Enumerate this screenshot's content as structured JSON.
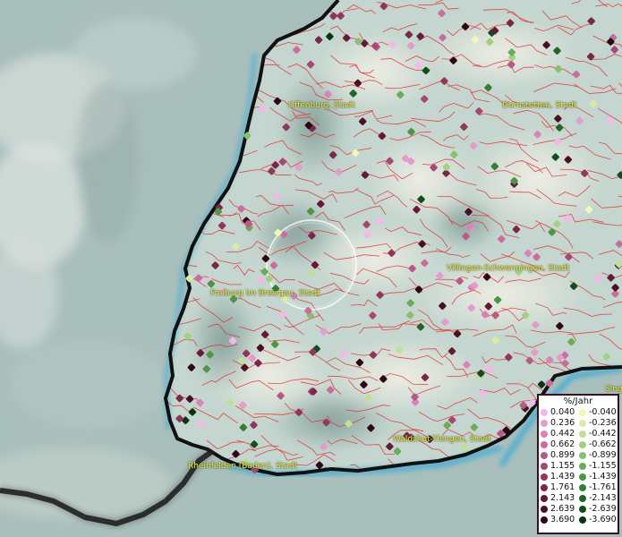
{
  "map": {
    "place_labels": [
      {
        "id": "offenburg",
        "text": "Offenburg, Stadt"
      },
      {
        "id": "dornstetten",
        "text": "Dornstetten, Stadt"
      },
      {
        "id": "villingen",
        "text": "Villingen-Schwenningen, Stadt"
      },
      {
        "id": "freiburg",
        "text": "Freiburg im Breisgau, Stadt"
      },
      {
        "id": "waldshut",
        "text": "Waldshut-Tiengen, Stadt"
      },
      {
        "id": "rheinfelden",
        "text": "Rheinfelden (Baden), Stadt"
      },
      {
        "id": "singen",
        "text": "Sing"
      }
    ],
    "colors": {
      "land": "#c9d8d0",
      "water": "#8fb0b0",
      "boundary": "#e03030",
      "border_outline": "#111111",
      "lake_shore": "#35a8d8",
      "label": "#e8f04a"
    }
  },
  "legend": {
    "title": "%/Jahr",
    "positive": [
      {
        "value": "0.040",
        "color": "#f4b8e8"
      },
      {
        "value": "0.236",
        "color": "#e49ccc"
      },
      {
        "value": "0.442",
        "color": "#d884b8"
      },
      {
        "value": "0.662",
        "color": "#c86e9e"
      },
      {
        "value": "0.899",
        "color": "#b85a88"
      },
      {
        "value": "1.155",
        "color": "#a54872"
      },
      {
        "value": "1.439",
        "color": "#90385c"
      },
      {
        "value": "1.761",
        "color": "#7a2848"
      },
      {
        "value": "2.143",
        "color": "#641a36"
      },
      {
        "value": "2.639",
        "color": "#4a0f24"
      },
      {
        "value": "3.690",
        "color": "#2e0614"
      }
    ],
    "negative": [
      {
        "value": "-0.040",
        "color": "#f0f8b8"
      },
      {
        "value": "-0.236",
        "color": "#d8eca8"
      },
      {
        "value": "-0.442",
        "color": "#c0e098"
      },
      {
        "value": "-0.662",
        "color": "#a4d084"
      },
      {
        "value": "-0.899",
        "color": "#88c070"
      },
      {
        "value": "-1.155",
        "color": "#6aac58"
      },
      {
        "value": "-1.439",
        "color": "#4e9644"
      },
      {
        "value": "-1.761",
        "color": "#357e34"
      },
      {
        "value": "-2.143",
        "color": "#206626"
      },
      {
        "value": "-2.639",
        "color": "#124e1a"
      },
      {
        "value": "-3.690",
        "color": "#083610"
      }
    ]
  }
}
